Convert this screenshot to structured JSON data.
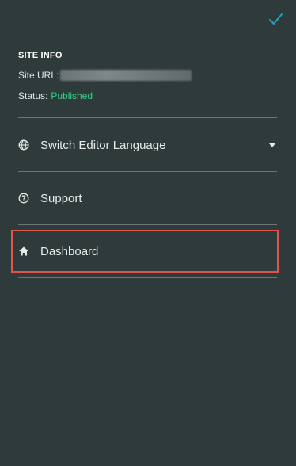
{
  "site_info": {
    "heading": "SITE INFO",
    "url_label": "Site URL:",
    "status_label": "Status:",
    "status_value": "Published",
    "status_color": "#32d28a"
  },
  "menu": {
    "items": [
      {
        "label": "Switch Editor Language",
        "icon": "globe-icon",
        "has_dropdown": true
      },
      {
        "label": "Support",
        "icon": "question-circle-icon",
        "has_dropdown": false
      },
      {
        "label": "Dashboard",
        "icon": "home-icon",
        "has_dropdown": false,
        "highlighted": true
      }
    ]
  },
  "colors": {
    "background": "#2f3a3a",
    "accent": "#1fa3c4",
    "highlight_border": "#e0554b"
  }
}
